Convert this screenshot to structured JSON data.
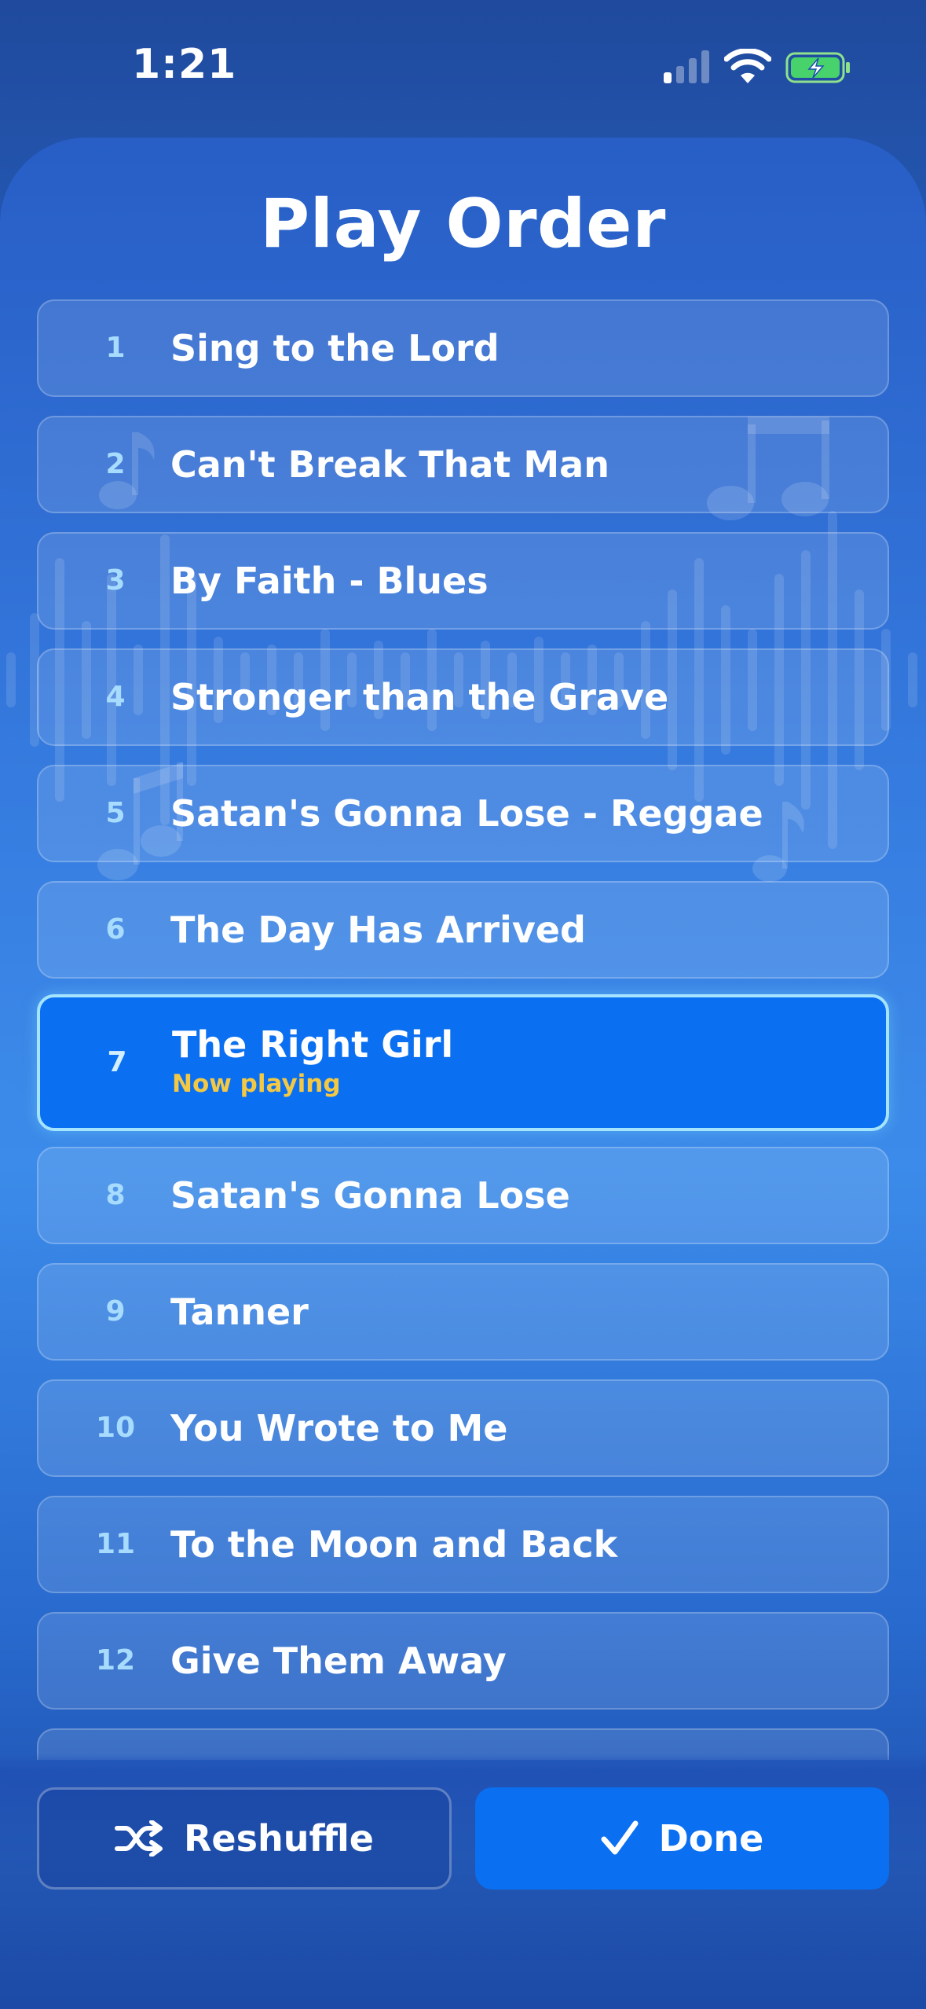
{
  "status_bar": {
    "time": "1:21"
  },
  "sheet": {
    "title": "Play Order"
  },
  "tracks": [
    {
      "num": "1",
      "title": "Sing to the Lord"
    },
    {
      "num": "2",
      "title": "Can't Break That Man"
    },
    {
      "num": "3",
      "title": "By Faith - Blues"
    },
    {
      "num": "4",
      "title": "Stronger than the Grave"
    },
    {
      "num": "5",
      "title": "Satan's Gonna Lose - Reggae"
    },
    {
      "num": "6",
      "title": "The Day Has Arrived"
    },
    {
      "num": "7",
      "title": "The Right Girl",
      "status": "Now playing"
    },
    {
      "num": "8",
      "title": "Satan's Gonna Lose"
    },
    {
      "num": "9",
      "title": "Tanner"
    },
    {
      "num": "10",
      "title": "You Wrote to Me"
    },
    {
      "num": "11",
      "title": "To the Moon and Back"
    },
    {
      "num": "12",
      "title": "Give Them Away"
    }
  ],
  "buttons": {
    "reshuffle": "Reshuffle",
    "done": "Done"
  },
  "colors": {
    "accent": "#0a6ff0",
    "now_playing": "#f3c844",
    "number": "#a8dcff"
  },
  "icons": {
    "reshuffle": "shuffle-icon",
    "done": "checkmark-icon"
  }
}
